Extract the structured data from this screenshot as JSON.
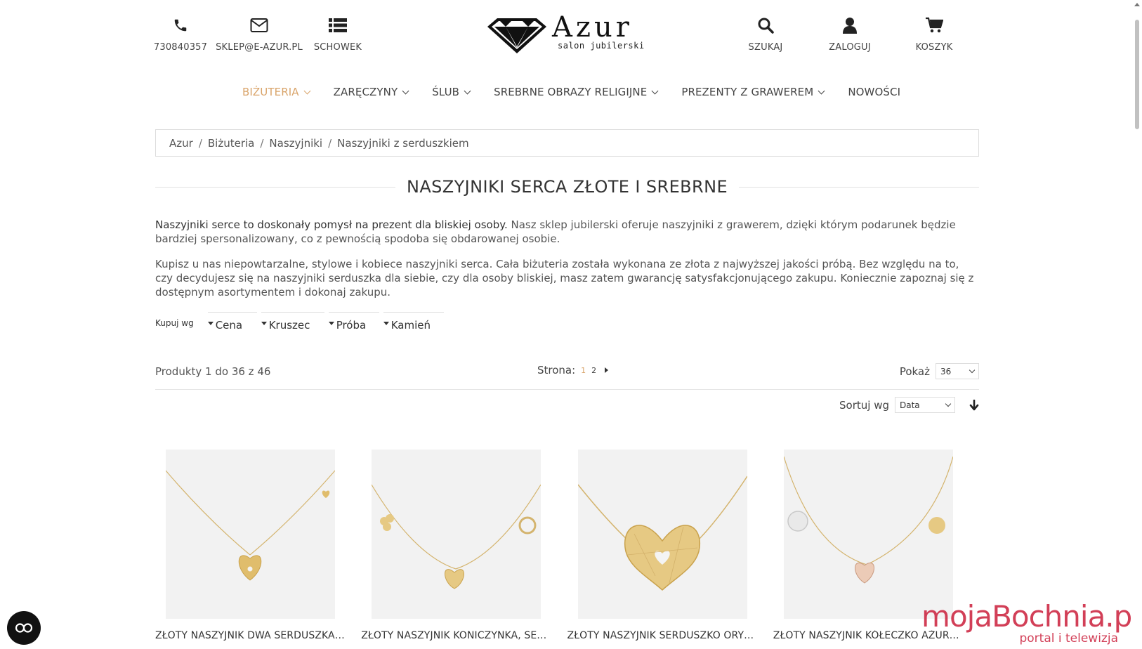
{
  "header": {
    "contacts": [
      {
        "icon": "phone-icon",
        "label": "730840357"
      },
      {
        "icon": "envelope-icon",
        "label": "SKLEP@E-AZUR.PL"
      },
      {
        "icon": "list-icon",
        "label": "SCHOWEK"
      }
    ],
    "logo": {
      "word": "Azur",
      "sub": "salon jubilerski"
    },
    "actions": [
      {
        "icon": "search-icon",
        "label": "SZUKAJ"
      },
      {
        "icon": "user-icon",
        "label": "ZALOGUJ"
      },
      {
        "icon": "cart-icon",
        "label": "KOSZYK"
      }
    ]
  },
  "nav": [
    {
      "label": "BIŻUTERIA",
      "dropdown": true,
      "active": true
    },
    {
      "label": "ZARĘCZYNY",
      "dropdown": true
    },
    {
      "label": "ŚLUB",
      "dropdown": true
    },
    {
      "label": "SREBRNE OBRAZY RELIGIJNE",
      "dropdown": true
    },
    {
      "label": "PREZENTY Z GRAWEREM",
      "dropdown": true
    },
    {
      "label": "NOWOŚCI",
      "dropdown": false
    }
  ],
  "colors": {
    "accent": "#d9a46a",
    "watermark": "#c8102e"
  },
  "breadcrumb": [
    "Azur",
    "Biżuteria",
    "Naszyjniki",
    "Naszyjniki z serduszkiem"
  ],
  "title": "NASZYJNIKI SERCA ZŁOTE I SREBRNE",
  "description": {
    "p1_bold": "Naszyjniki serce to doskonały pomysł na prezent dla bliskiej osoby.",
    "p1_rest": " Nasz sklep jubilerski oferuje naszyjniki z grawerem, dzięki którym podarunek będzie bardziej spersonalizowany, co z pewnością spodoba się obdarowanej osobie.",
    "p2": "Kupisz u nas niepowtarzalne, stylowe i kobiece naszyjniki serca. Cała biżuteria została wykonana ze złota z najwyższej jakości próbą. Bez względu na to, czy decydujesz się na naszyjniki serduszka dla siebie, czy dla osoby bliskiej, masz zatem gwarancję satysfakcjonującego zakupu. Koniecznie zapoznaj się z dostępnym asortymentem i dokonaj zakupu."
  },
  "filters": {
    "label": "Kupuj wg",
    "items": [
      "Cena",
      "Kruszec",
      "Próba",
      "Kamień"
    ]
  },
  "toolbar": {
    "count": "Produkty 1 do 36 z 46",
    "page_label": "Strona:",
    "pages": [
      "1",
      "2"
    ],
    "current_page": "1",
    "show_label": "Pokaż",
    "show_value": "36",
    "sort_label": "Sortuj wg",
    "sort_value": "Data"
  },
  "products": [
    {
      "name": "ZŁOTY NASZYJNIK DWA SERDUSZKA CELEBRYTKA"
    },
    {
      "name": "ZŁOTY NASZYJNIK KONICZYNKA, SERDUSZKO, KÓŁKO"
    },
    {
      "name": "ZŁOTY NASZYJNIK SERDUSZKO ORYGINALNE"
    },
    {
      "name": "ZŁOTY NASZYJNIK KÓŁECZKO AŻUROWE SERCE"
    }
  ],
  "watermark": {
    "big": "mojaBochnia.pl",
    "small": "portal i telewizja"
  }
}
